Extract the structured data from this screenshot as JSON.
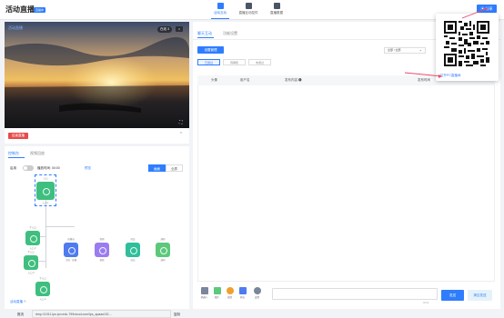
{
  "header": {
    "title": "活动直播",
    "badge": "直播中",
    "nav": [
      {
        "label": "活动互动",
        "icon": "live-icon",
        "active": true
      },
      {
        "label": "直播互动控件",
        "icon": "control-icon",
        "active": false
      },
      {
        "label": "直播数据",
        "icon": "data-icon",
        "active": false
      }
    ],
    "share_label": "分享"
  },
  "video": {
    "label": "活动直播",
    "pill": "在线 3",
    "square": "□",
    "fullscreen": "⛶"
  },
  "end_button": "结束直播",
  "collapse": "^",
  "left_tabs": [
    "控制台",
    "视频回放"
  ],
  "control": {
    "enable_label": "启用",
    "delay_label": "播放时间: 00:00",
    "preview_link": "预览",
    "seg": [
      "画面",
      "全屏"
    ]
  },
  "flow": {
    "nodes": [
      {
        "label": "入口",
        "sub": "入口 1",
        "color": "green"
      },
      {
        "label": "子入口",
        "sub": "入口 2",
        "color": "green"
      },
      {
        "label": "子入口",
        "sub": "入口 3",
        "color": "green"
      },
      {
        "label": "子入口",
        "sub": "入口 4",
        "color": "green"
      },
      {
        "label": "直播间",
        "sub": "主推 · 直播",
        "color": "blue"
      },
      {
        "label": "视频",
        "sub": "视频",
        "color": "purple"
      },
      {
        "label": "商品",
        "sub": "商品",
        "color": "teal"
      },
      {
        "label": "通知",
        "sub": "通知",
        "color": "lgreen"
      }
    ]
  },
  "live_link": "活动直播",
  "push": {
    "label": "推流",
    "url": "rtmp://1011.lps.ipn.edu.799cloud.com/lps_apaas101...",
    "copy": "复制"
  },
  "right_tabs": [
    "聊天互动",
    "功能设置"
  ],
  "manage_button": "设置管理",
  "filter_value": "全部 / 全部",
  "msg_tabs": [
    "已通过",
    "待审核",
    "未通过"
  ],
  "table_headers": [
    "头像",
    "用户名",
    "发布内容 ❶",
    "发布时间"
  ],
  "toolbar": [
    {
      "label": "机器人",
      "color": "#7a869a"
    },
    {
      "label": "图片",
      "color": "#5cc97a"
    },
    {
      "label": "表情",
      "color": "#f0a030"
    },
    {
      "label": "开启",
      "color": "#4e7bf0"
    },
    {
      "label": "设置",
      "color": "#7a869a"
    }
  ],
  "chat_count": "0/140",
  "send_label": "发送",
  "clear_label": "清空发送",
  "qr_link": "打开PC直播间"
}
